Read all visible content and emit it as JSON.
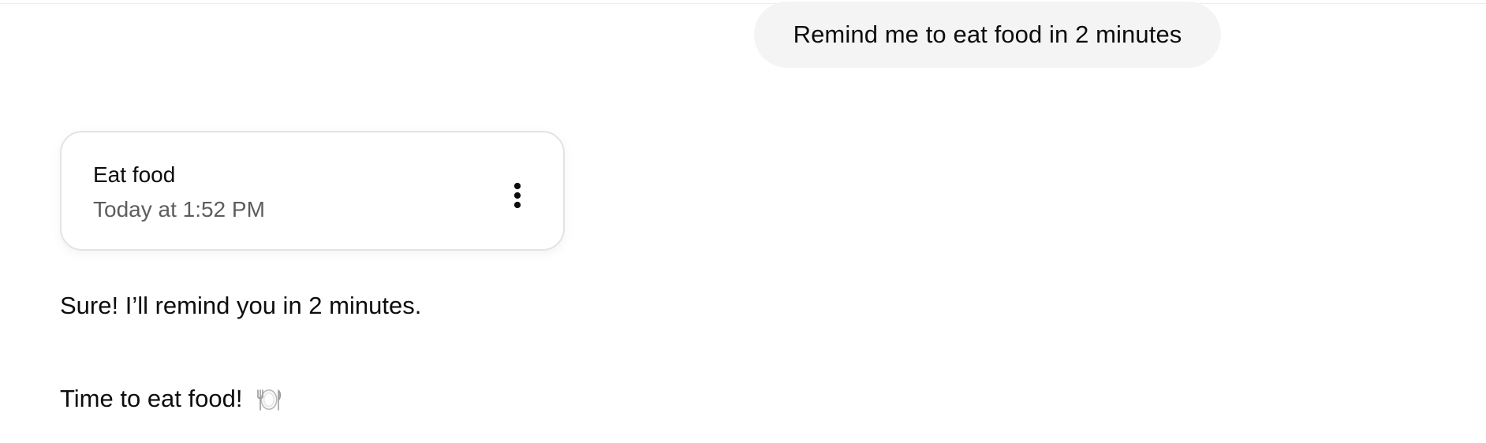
{
  "user_message": {
    "text": "Remind me to eat food in 2 minutes"
  },
  "reminder_card": {
    "title": "Eat food",
    "time": "Today at 1:52 PM",
    "more_icon": "vertical-ellipsis-icon"
  },
  "assistant_messages": {
    "confirmation": "Sure! I’ll remind you in 2 minutes.",
    "reminder_text": "Time to eat food!",
    "reminder_icon": "plate-with-cutlery-icon"
  },
  "colors": {
    "user_bubble_bg": "#f4f4f4",
    "card_border": "#e3e3e3",
    "secondary_text": "#5d5d5d",
    "primary_text": "#0d0d0d"
  }
}
